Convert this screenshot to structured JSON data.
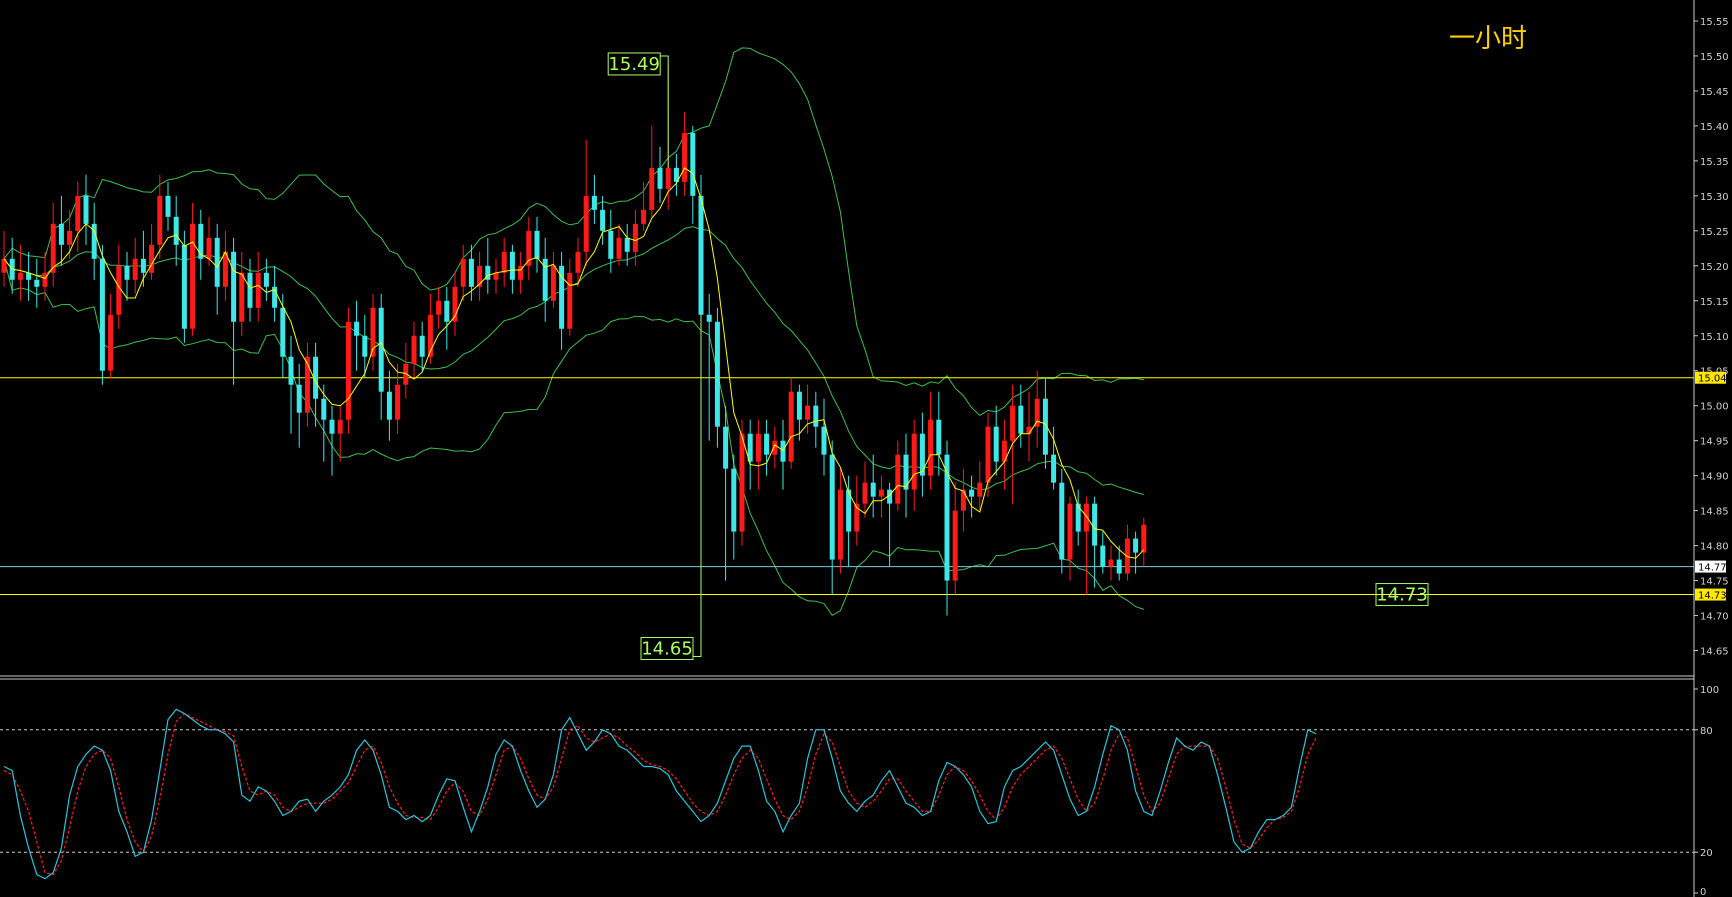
{
  "timeframe_label": "一小时",
  "colors": {
    "background": "#000000",
    "up_candle": "#ff1a1a",
    "down_candle": "#3ee8e8",
    "bollinger": "#3fbf4f",
    "ma_fast": "#ffff00",
    "hline": "#ffff00",
    "current_line": "#7fc8e0",
    "annotation": "#a8ff60",
    "stoch_k": "#2ec4d8",
    "stoch_d": "#ff2020",
    "stoch_level": "#cccccc"
  },
  "price_ticks": [
    "15.55",
    "15.50",
    "15.45",
    "15.40",
    "15.35",
    "15.30",
    "15.25",
    "15.20",
    "15.15",
    "15.10",
    "15.05",
    "15.00",
    "14.95",
    "14.90",
    "14.85",
    "14.80",
    "14.75",
    "14.70",
    "14.65"
  ],
  "price_badges": [
    {
      "text": "15.04",
      "value": 15.04,
      "style": "yellow"
    },
    {
      "text": "14.77",
      "value": 14.77,
      "style": "white"
    },
    {
      "text": "14.73",
      "value": 14.73,
      "style": "yellow"
    }
  ],
  "annotations": [
    {
      "text": "15.49",
      "value": 15.49,
      "kind": "high"
    },
    {
      "text": "14.65",
      "value": 14.65,
      "kind": "low"
    },
    {
      "text": "14.73",
      "value": 14.73,
      "kind": "support"
    }
  ],
  "stoch_ticks": [
    "100",
    "80",
    "20",
    "0"
  ],
  "chart_data": [
    {
      "type": "candlestick",
      "title": "",
      "ylim": [
        14.615,
        15.58
      ],
      "grid": false,
      "horizontal_lines": [
        15.04,
        14.77,
        14.73
      ],
      "candles": [
        [
          15.19,
          15.21,
          15.25,
          15.17
        ],
        [
          15.21,
          15.18,
          15.24,
          15.16
        ],
        [
          15.18,
          15.19,
          15.23,
          15.15
        ],
        [
          15.19,
          15.18,
          15.22,
          15.15
        ],
        [
          15.18,
          15.17,
          15.21,
          15.14
        ],
        [
          15.17,
          15.19,
          15.22,
          15.15
        ],
        [
          15.19,
          15.26,
          15.29,
          15.17
        ],
        [
          15.26,
          15.23,
          15.3,
          15.2
        ],
        [
          15.23,
          15.25,
          15.28,
          15.21
        ],
        [
          15.25,
          15.3,
          15.32,
          15.22
        ],
        [
          15.3,
          15.26,
          15.33,
          15.23
        ],
        [
          15.26,
          15.21,
          15.29,
          15.18
        ],
        [
          15.21,
          15.05,
          15.23,
          15.03
        ],
        [
          15.05,
          15.13,
          15.16,
          15.04
        ],
        [
          15.13,
          15.2,
          15.23,
          15.11
        ],
        [
          15.2,
          15.18,
          15.22,
          15.15
        ],
        [
          15.18,
          15.21,
          15.24,
          15.16
        ],
        [
          15.21,
          15.19,
          15.25,
          15.17
        ],
        [
          15.19,
          15.23,
          15.26,
          15.18
        ],
        [
          15.23,
          15.3,
          15.33,
          15.21
        ],
        [
          15.3,
          15.27,
          15.32,
          15.25
        ],
        [
          15.27,
          15.23,
          15.3,
          15.2
        ],
        [
          15.23,
          15.11,
          15.25,
          15.09
        ],
        [
          15.11,
          15.26,
          15.29,
          15.1
        ],
        [
          15.26,
          15.21,
          15.28,
          15.18
        ],
        [
          15.21,
          15.24,
          15.27,
          15.2
        ],
        [
          15.24,
          15.17,
          15.26,
          15.13
        ],
        [
          15.17,
          15.22,
          15.25,
          15.15
        ],
        [
          15.22,
          15.12,
          15.24,
          15.03
        ],
        [
          15.12,
          15.19,
          15.22,
          15.1
        ],
        [
          15.19,
          15.14,
          15.21,
          15.12
        ],
        [
          15.14,
          15.19,
          15.22,
          15.12
        ],
        [
          15.19,
          15.17,
          15.21,
          15.15
        ],
        [
          15.17,
          15.14,
          15.2,
          15.12
        ],
        [
          15.14,
          15.07,
          15.16,
          15.04
        ],
        [
          15.07,
          15.03,
          15.1,
          14.96
        ],
        [
          15.03,
          14.99,
          15.06,
          14.94
        ],
        [
          14.99,
          15.07,
          15.09,
          14.97
        ],
        [
          15.07,
          15.01,
          15.09,
          14.97
        ],
        [
          15.01,
          14.98,
          15.03,
          14.92
        ],
        [
          14.98,
          14.96,
          15.0,
          14.9
        ],
        [
          14.96,
          14.98,
          15.0,
          14.92
        ],
        [
          14.98,
          15.12,
          15.14,
          14.96
        ],
        [
          15.12,
          15.1,
          15.15,
          15.05
        ],
        [
          15.1,
          15.07,
          15.13,
          15.04
        ],
        [
          15.07,
          15.14,
          15.16,
          15.05
        ],
        [
          15.14,
          15.02,
          15.16,
          14.98
        ],
        [
          15.02,
          14.98,
          15.05,
          14.95
        ],
        [
          14.98,
          15.03,
          15.06,
          14.96
        ],
        [
          15.03,
          15.06,
          15.09,
          15.01
        ],
        [
          15.06,
          15.1,
          15.12,
          15.04
        ],
        [
          15.1,
          15.07,
          15.12,
          15.05
        ],
        [
          15.07,
          15.13,
          15.16,
          15.06
        ],
        [
          15.13,
          15.15,
          15.17,
          15.11
        ],
        [
          15.15,
          15.12,
          15.17,
          15.08
        ],
        [
          15.12,
          15.17,
          15.19,
          15.1
        ],
        [
          15.17,
          15.21,
          15.23,
          15.15
        ],
        [
          15.21,
          15.17,
          15.23,
          15.15
        ],
        [
          15.17,
          15.2,
          15.22,
          15.15
        ],
        [
          15.2,
          15.18,
          15.24,
          15.16
        ],
        [
          15.18,
          15.19,
          15.21,
          15.16
        ],
        [
          15.19,
          15.22,
          15.24,
          15.17
        ],
        [
          15.22,
          15.18,
          15.23,
          15.16
        ],
        [
          15.18,
          15.2,
          15.22,
          15.16
        ],
        [
          15.2,
          15.25,
          15.27,
          15.18
        ],
        [
          15.25,
          15.21,
          15.27,
          15.19
        ],
        [
          15.21,
          15.15,
          15.24,
          15.12
        ],
        [
          15.15,
          15.2,
          15.22,
          15.14
        ],
        [
          15.2,
          15.11,
          15.22,
          15.08
        ],
        [
          15.11,
          15.19,
          15.21,
          15.1
        ],
        [
          15.19,
          15.22,
          15.24,
          15.17
        ],
        [
          15.22,
          15.3,
          15.38,
          15.2
        ],
        [
          15.3,
          15.28,
          15.33,
          15.26
        ],
        [
          15.28,
          15.25,
          15.3,
          15.23
        ],
        [
          15.25,
          15.21,
          15.28,
          15.19
        ],
        [
          15.21,
          15.24,
          15.26,
          15.2
        ],
        [
          15.24,
          15.22,
          15.26,
          15.2
        ],
        [
          15.22,
          15.26,
          15.28,
          15.2
        ],
        [
          15.26,
          15.28,
          15.32,
          15.25
        ],
        [
          15.28,
          15.34,
          15.4,
          15.27
        ],
        [
          15.34,
          15.31,
          15.37,
          15.29
        ],
        [
          15.31,
          15.34,
          15.49,
          15.28
        ],
        [
          15.34,
          15.32,
          15.36,
          15.3
        ],
        [
          15.32,
          15.39,
          15.42,
          15.3
        ],
        [
          15.39,
          15.3,
          15.4,
          15.26
        ],
        [
          15.3,
          15.13,
          15.33,
          14.65
        ],
        [
          15.13,
          15.12,
          15.16,
          14.95
        ],
        [
          15.12,
          14.97,
          15.14,
          14.94
        ],
        [
          14.97,
          14.91,
          15.0,
          14.75
        ],
        [
          14.91,
          14.82,
          14.93,
          14.78
        ],
        [
          14.82,
          14.96,
          14.98,
          14.8
        ],
        [
          14.96,
          14.92,
          14.98,
          14.88
        ],
        [
          14.92,
          14.96,
          14.98,
          14.88
        ],
        [
          14.96,
          14.93,
          14.98,
          14.9
        ],
        [
          14.93,
          14.95,
          14.97,
          14.91
        ],
        [
          14.95,
          14.92,
          14.98,
          14.88
        ],
        [
          14.92,
          15.02,
          15.04,
          14.91
        ],
        [
          15.02,
          14.98,
          15.03,
          14.95
        ],
        [
          14.98,
          15.0,
          15.03,
          14.96
        ],
        [
          15.0,
          14.97,
          15.02,
          14.94
        ],
        [
          14.97,
          14.93,
          15.01,
          14.9
        ],
        [
          14.93,
          14.78,
          14.95,
          14.73
        ],
        [
          14.78,
          14.88,
          14.91,
          14.76
        ],
        [
          14.88,
          14.82,
          14.9,
          14.77
        ],
        [
          14.82,
          14.86,
          14.9,
          14.8
        ],
        [
          14.86,
          14.89,
          14.92,
          14.84
        ],
        [
          14.89,
          14.87,
          14.93,
          14.84
        ],
        [
          14.87,
          14.88,
          14.9,
          14.84
        ],
        [
          14.88,
          14.86,
          14.89,
          14.77
        ],
        [
          14.86,
          14.93,
          14.95,
          14.85
        ],
        [
          14.93,
          14.88,
          14.96,
          14.84
        ],
        [
          14.88,
          14.96,
          14.98,
          14.85
        ],
        [
          14.96,
          14.9,
          14.99,
          14.87
        ],
        [
          14.9,
          14.98,
          15.02,
          14.88
        ],
        [
          14.98,
          14.93,
          15.02,
          14.9
        ],
        [
          14.93,
          14.75,
          14.95,
          14.7
        ],
        [
          14.75,
          14.85,
          14.89,
          14.73
        ],
        [
          14.85,
          14.88,
          14.91,
          14.82
        ],
        [
          14.88,
          14.87,
          14.9,
          14.84
        ],
        [
          14.87,
          14.89,
          14.92,
          14.85
        ],
        [
          14.89,
          14.97,
          14.99,
          14.87
        ],
        [
          14.97,
          14.92,
          15.0,
          14.9
        ],
        [
          14.92,
          14.95,
          14.98,
          14.88
        ],
        [
          14.95,
          15.0,
          15.03,
          14.86
        ],
        [
          15.0,
          14.96,
          15.03,
          14.94
        ],
        [
          14.96,
          14.97,
          15.02,
          14.92
        ],
        [
          14.97,
          15.01,
          15.05,
          14.94
        ],
        [
          15.01,
          14.93,
          15.04,
          14.91
        ],
        [
          14.93,
          14.89,
          14.97,
          14.88
        ],
        [
          14.89,
          14.78,
          14.91,
          14.76
        ],
        [
          14.78,
          14.86,
          14.87,
          14.75
        ],
        [
          14.86,
          14.82,
          14.88,
          14.8
        ],
        [
          14.82,
          14.86,
          14.87,
          14.73
        ],
        [
          14.86,
          14.8,
          14.87,
          14.74
        ],
        [
          14.8,
          14.77,
          14.82,
          14.76
        ],
        [
          14.77,
          14.78,
          14.8,
          14.75
        ],
        [
          14.78,
          14.76,
          14.8,
          14.75
        ],
        [
          14.76,
          14.81,
          14.83,
          14.75
        ],
        [
          14.81,
          14.79,
          14.82,
          14.76
        ],
        [
          14.79,
          14.83,
          14.84,
          14.77
        ]
      ]
    },
    {
      "type": "line",
      "title": "",
      "ylim": [
        0,
        100
      ],
      "levels": [
        80,
        20
      ],
      "series": [
        {
          "style": "solid",
          "values": [
            62,
            60,
            38,
            22,
            9,
            7,
            10,
            22,
            48,
            62,
            68,
            72,
            70,
            60,
            40,
            30,
            18,
            20,
            36,
            60,
            85,
            90,
            88,
            85,
            82,
            80,
            80,
            78,
            74,
            48,
            45,
            52,
            50,
            45,
            38,
            40,
            45,
            46,
            40,
            45,
            48,
            52,
            58,
            70,
            75,
            70,
            58,
            42,
            40,
            36,
            38,
            35,
            38,
            48,
            56,
            55,
            42,
            30,
            40,
            52,
            68,
            75,
            72,
            60,
            50,
            42,
            46,
            58,
            80,
            86,
            78,
            70,
            74,
            80,
            78,
            72,
            70,
            66,
            62,
            62,
            61,
            58,
            50,
            45,
            40,
            35,
            38,
            44,
            55,
            66,
            72,
            72,
            60,
            45,
            40,
            30,
            38,
            44,
            66,
            80,
            80,
            66,
            50,
            44,
            40,
            45,
            48,
            55,
            60,
            52,
            44,
            42,
            38,
            40,
            55,
            64,
            62,
            58,
            52,
            40,
            34,
            35,
            52,
            60,
            62,
            66,
            70,
            74,
            70,
            58,
            46,
            38,
            40,
            52,
            68,
            82,
            80,
            70,
            50,
            40,
            38,
            50,
            64,
            76,
            72,
            70,
            74,
            72,
            58,
            42,
            25,
            20,
            22,
            30,
            36,
            36,
            38,
            42,
            62,
            80,
            78
          ]
        },
        {
          "style": "dashed",
          "values": [
            60,
            58,
            50,
            40,
            25,
            10,
            9,
            16,
            32,
            50,
            62,
            68,
            70,
            66,
            52,
            36,
            25,
            20,
            28,
            46,
            68,
            84,
            88,
            86,
            84,
            82,
            80,
            79,
            77,
            62,
            50,
            48,
            50,
            48,
            42,
            40,
            42,
            44,
            44,
            44,
            46,
            50,
            54,
            62,
            70,
            72,
            64,
            52,
            44,
            38,
            37,
            37,
            36,
            42,
            50,
            54,
            50,
            40,
            38,
            46,
            58,
            70,
            72,
            66,
            56,
            48,
            46,
            52,
            66,
            80,
            82,
            76,
            74,
            76,
            78,
            76,
            72,
            69,
            65,
            63,
            62,
            60,
            56,
            50,
            44,
            40,
            38,
            40,
            48,
            58,
            66,
            70,
            66,
            56,
            46,
            38,
            36,
            40,
            52,
            68,
            78,
            74,
            62,
            50,
            44,
            42,
            45,
            50,
            56,
            56,
            50,
            45,
            40,
            40,
            48,
            58,
            62,
            60,
            55,
            48,
            40,
            36,
            42,
            52,
            58,
            62,
            66,
            70,
            72,
            66,
            56,
            46,
            40,
            44,
            56,
            70,
            78,
            76,
            62,
            48,
            40,
            44,
            56,
            68,
            72,
            72,
            72,
            72,
            66,
            52,
            36,
            24,
            22,
            26,
            32,
            36,
            37,
            40,
            52,
            68,
            76
          ]
        }
      ]
    }
  ]
}
